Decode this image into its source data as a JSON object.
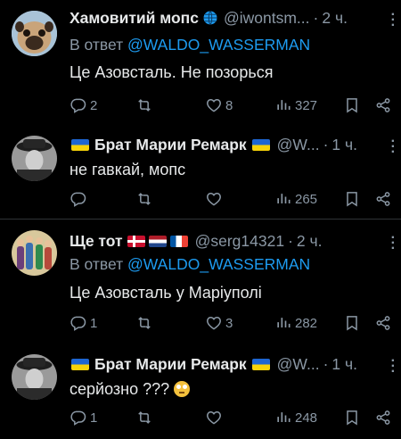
{
  "tweets": [
    {
      "name": "Хамовитий мопс",
      "handle": "@iwontsm...",
      "time": "2 ч.",
      "reply_prefix": "В ответ",
      "reply_to": "@WALDO_WASSERMAN",
      "text": "Це Азовсталь. Не позорься",
      "replies": "2",
      "retweets": "",
      "likes": "8",
      "views": "327"
    },
    {
      "name": "Брат Марии Ремарк",
      "handle": "@W...",
      "time": "1 ч.",
      "text": "не гавкай, мопс",
      "replies": "",
      "retweets": "",
      "likes": "",
      "views": "265"
    },
    {
      "name": "Ще тот",
      "handle": "@serg14321",
      "time": "2 ч.",
      "reply_prefix": "В ответ",
      "reply_to": "@WALDO_WASSERMAN",
      "text": "Це Азовсталь у Маріуполі",
      "replies": "1",
      "retweets": "",
      "likes": "3",
      "views": "282"
    },
    {
      "name": "Брат Марии Ремарк",
      "handle": "@W...",
      "time": "1 ч.",
      "text": "серйозно ???",
      "replies": "1",
      "retweets": "",
      "likes": "",
      "views": "248"
    }
  ],
  "colors": {
    "background": "#000000",
    "accent": "#1d9bf0",
    "muted": "#8b98a5",
    "text": "#e7e9ea",
    "divider": "#2f3336"
  }
}
